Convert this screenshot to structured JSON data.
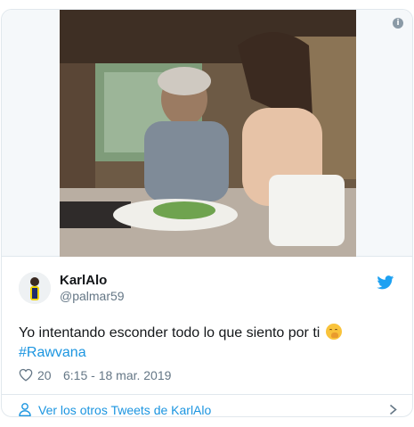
{
  "tweet": {
    "author_name": "KarlAlo",
    "author_handle": "@palmar59",
    "text": "Yo intentando esconder todo lo que siento por ti",
    "hashtag": "#Rawvana",
    "likes": "20",
    "timestamp": "6:15 - 18 mar. 2019"
  },
  "footer": {
    "link_label": "Ver los otros Tweets de KarlAlo"
  },
  "icons": {
    "info": "info-icon",
    "twitter": "twitter-bird-icon",
    "heart": "heart-icon",
    "person": "person-icon",
    "chevron": "chevron-right-icon",
    "emoji": "face-with-hand-over-mouth-emoji"
  },
  "colors": {
    "link": "#1b95e0",
    "secondary_text": "#657786",
    "border": "#e1e8ed"
  }
}
